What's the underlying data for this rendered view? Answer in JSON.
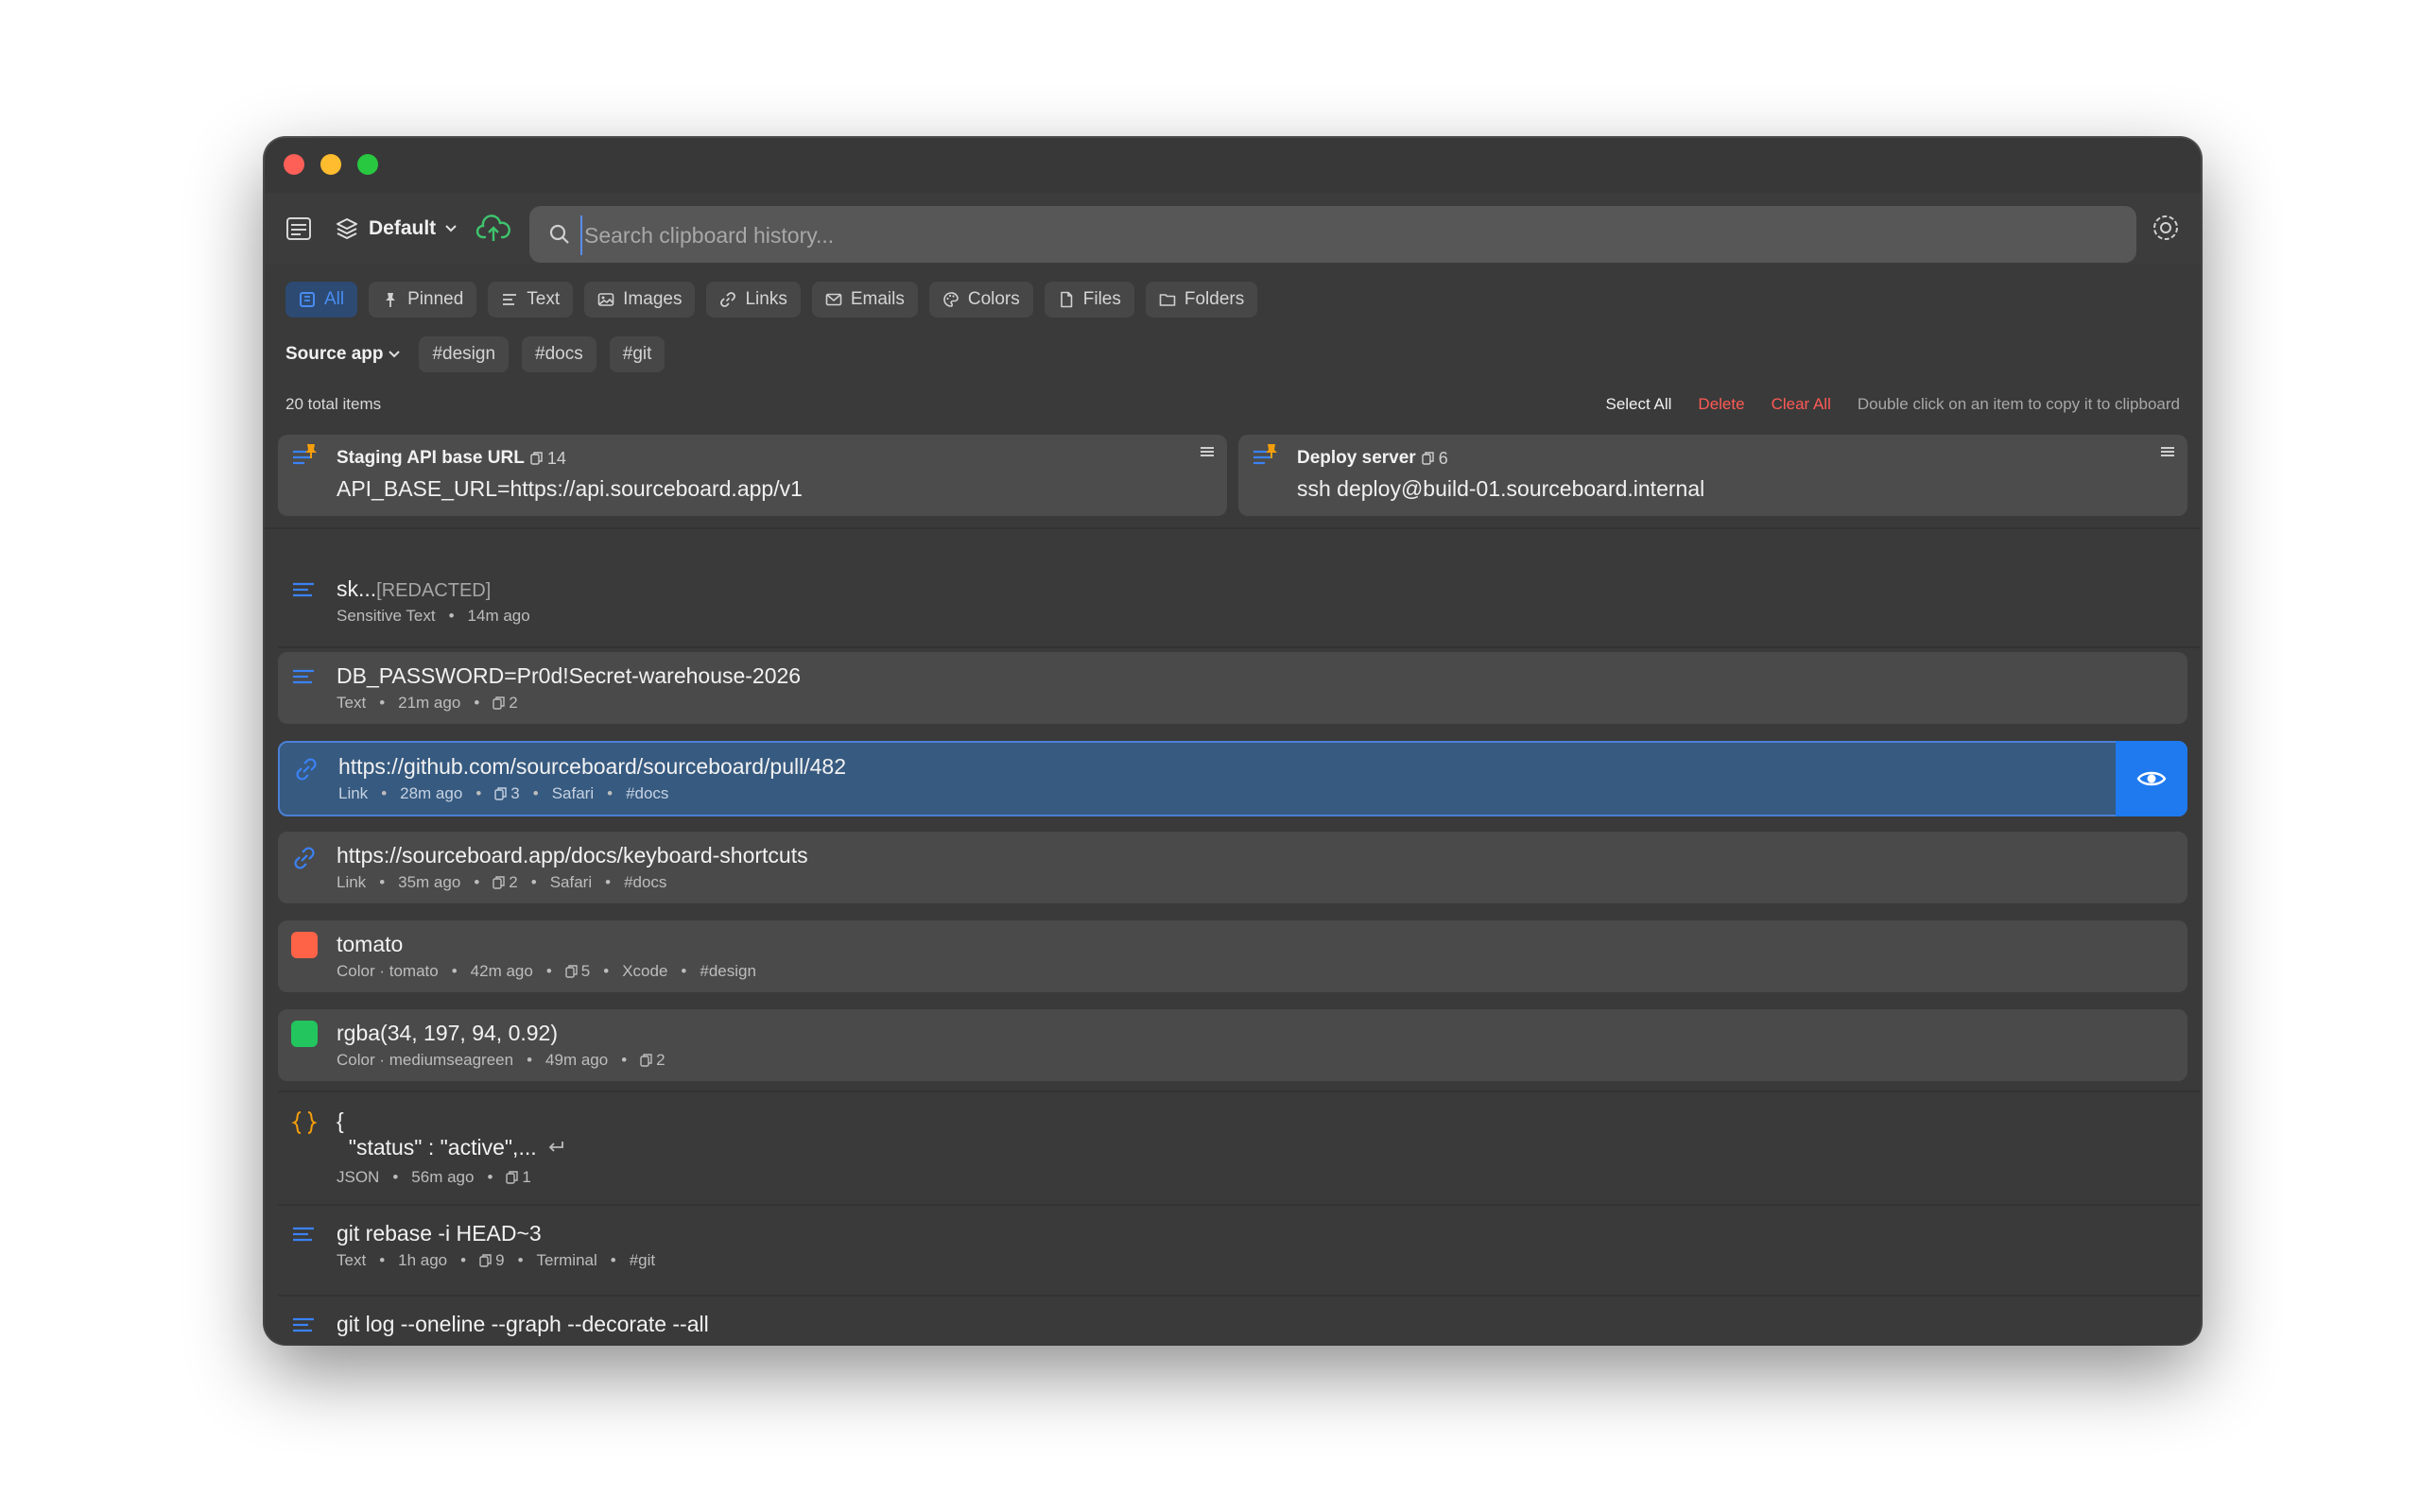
{
  "toolbar": {
    "profile_label": "Default",
    "search_placeholder": "Search clipboard history..."
  },
  "filters": [
    {
      "label": "All",
      "icon": "all-icon",
      "active": true
    },
    {
      "label": "Pinned",
      "icon": "pin-icon"
    },
    {
      "label": "Text",
      "icon": "text-icon"
    },
    {
      "label": "Images",
      "icon": "image-icon"
    },
    {
      "label": "Links",
      "icon": "link-icon"
    },
    {
      "label": "Emails",
      "icon": "mail-icon"
    },
    {
      "label": "Colors",
      "icon": "palette-icon"
    },
    {
      "label": "Files",
      "icon": "file-icon"
    },
    {
      "label": "Folders",
      "icon": "folder-icon"
    }
  ],
  "tags": {
    "source_app_label": "Source app",
    "items": [
      "#design",
      "#docs",
      "#git"
    ]
  },
  "meta": {
    "total": "20 total items",
    "select_all": "Select All",
    "delete": "Delete",
    "clear_all": "Clear All",
    "hint": "Double click on an item to copy it to clipboard"
  },
  "pinned": [
    {
      "title": "Staging API base URL",
      "count": "14",
      "body": "API_BASE_URL=https://api.sourceboard.app/v1"
    },
    {
      "title": "Deploy server",
      "count": "6",
      "body": "ssh deploy@build-01.sourceboard.internal"
    }
  ],
  "items": [
    {
      "title": "sk...",
      "redacted": "[REDACTED]",
      "type": "Sensitive Text",
      "time": "14m ago"
    },
    {
      "title": "DB_PASSWORD=Pr0d!Secret-warehouse-2026",
      "type": "Text",
      "time": "21m ago",
      "count": "2"
    },
    {
      "title": "https://github.com/sourceboard/sourceboard/pull/482",
      "type": "Link",
      "time": "28m ago",
      "count": "3",
      "app": "Safari",
      "tag": "#docs"
    },
    {
      "title": "https://sourceboard.app/docs/keyboard-shortcuts",
      "type": "Link",
      "time": "35m ago",
      "count": "2",
      "app": "Safari",
      "tag": "#docs"
    },
    {
      "title": "tomato",
      "type": "Color · tomato",
      "time": "42m ago",
      "count": "5",
      "app": "Xcode",
      "tag": "#design",
      "swatch": "#ff6347"
    },
    {
      "title": "rgba(34, 197, 94, 0.92)",
      "type": "Color · mediumseagreen",
      "time": "49m ago",
      "count": "2",
      "swatch": "#22c55e"
    },
    {
      "title_line1": "{",
      "title_line2": "  \"status\" : \"active\",...",
      "type": "JSON",
      "time": "56m ago",
      "count": "1"
    },
    {
      "title": "git rebase -i HEAD~3",
      "type": "Text",
      "time": "1h ago",
      "count": "9",
      "app": "Terminal",
      "tag": "#git"
    },
    {
      "title": "git log --oneline --graph --decorate --all"
    }
  ],
  "colors": {
    "accent": "#1f7af0",
    "danger": "#ff5a55",
    "link_icon": "#3b82f6",
    "json_icon": "#f59e0b",
    "pin_icon": "#f59e0b"
  }
}
